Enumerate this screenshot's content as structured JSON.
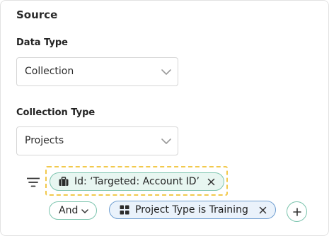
{
  "section": {
    "title": "Source"
  },
  "data_type": {
    "label": "Data Type",
    "value": "Collection"
  },
  "collection_type": {
    "label": "Collection Type",
    "value": "Projects"
  },
  "filters": {
    "primary_chip": {
      "text": "Id: ‘Targeted: Account ID’",
      "icon": "briefcase-icon"
    },
    "operator": {
      "value": "And"
    },
    "secondary_chip": {
      "text": "Project Type is Training",
      "icon": "grid-icon"
    }
  },
  "colors": {
    "accent_green": "#7cc4ae",
    "chip_green_bg": "#e8f6f1",
    "chip_blue_bg": "#eaf2fb",
    "chip_blue_border": "#6f9ed1",
    "highlight_dashed": "#f2c94c"
  }
}
